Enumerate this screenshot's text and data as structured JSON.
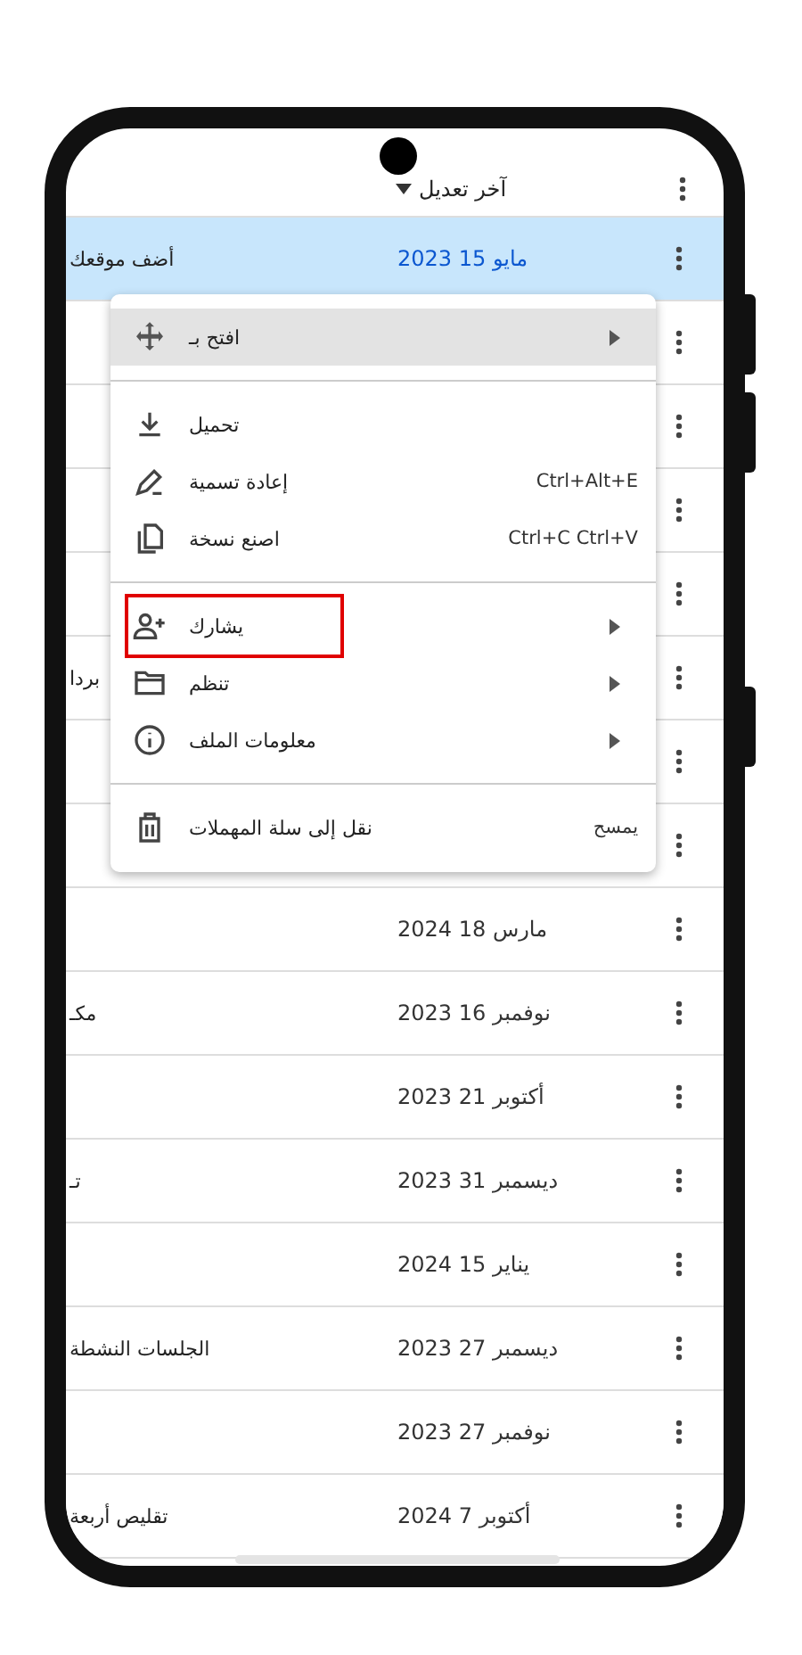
{
  "header": {
    "sort_label": "آخر تعديل"
  },
  "rows": [
    {
      "name": "أضف موقعك",
      "date": "مايو 15 2023",
      "selected": true
    },
    {
      "selected": false
    },
    {
      "selected": false
    },
    {
      "selected": false
    },
    {
      "selected": false
    },
    {
      "name": "بردا",
      "selected": false
    },
    {
      "selected": false
    },
    {
      "selected": false
    },
    {
      "date": "مارس 18 2024",
      "selected": false
    },
    {
      "name": "مكـ",
      "date": "نوفمبر 16 2023",
      "selected": false
    },
    {
      "date": "أكتوبر 21 2023",
      "selected": false
    },
    {
      "name": "تـ",
      "date": "ديسمبر 31 2023",
      "selected": false
    },
    {
      "date": "يناير 15 2024",
      "selected": false
    },
    {
      "name": "الجلسات النشطة",
      "date": "ديسمبر 27 2023",
      "selected": false
    },
    {
      "date": "نوفمبر 27 2023",
      "selected": false
    },
    {
      "name": "تقليص أربعة",
      "date": "أكتوبر 7 2024",
      "selected": false
    }
  ],
  "menu": {
    "groups": [
      [
        {
          "label": "افتح بـ",
          "submenu": true,
          "selected": true,
          "highlighted": false
        }
      ],
      [
        {
          "label": "تحميل",
          "submenu": false,
          "selected": false,
          "highlighted": false
        },
        {
          "label": "إعادة تسمية",
          "shortcut": "Ctrl+Alt+E",
          "submenu": false,
          "selected": false,
          "highlighted": false
        },
        {
          "label": "اصنع نسخة",
          "shortcut": "Ctrl+C Ctrl+V",
          "submenu": false,
          "selected": false,
          "highlighted": false
        }
      ],
      [
        {
          "label": "يشارك",
          "submenu": true,
          "selected": false,
          "highlighted": true
        },
        {
          "label": "تنظم",
          "submenu": true,
          "selected": false,
          "highlighted": false
        },
        {
          "label": "معلومات الملف",
          "submenu": true,
          "selected": false,
          "highlighted": false
        }
      ],
      [
        {
          "label": "نقل إلى سلة المهملات",
          "shortcut": "يمسح",
          "submenu": false,
          "selected": false,
          "highlighted": false
        }
      ]
    ]
  }
}
